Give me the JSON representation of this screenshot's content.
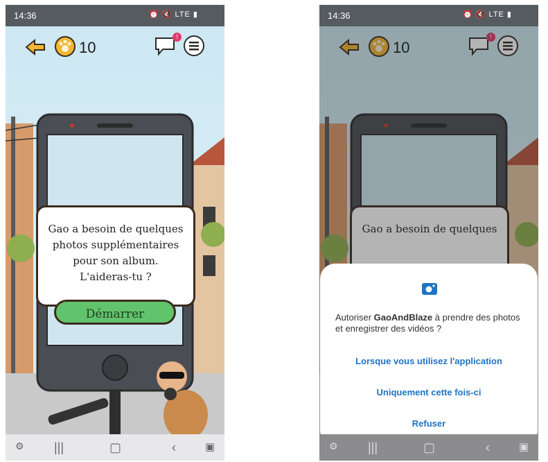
{
  "status": {
    "time": "14:36",
    "icons": "⏰ 🔇 LTE ▮"
  },
  "hud": {
    "paw_count": "10",
    "notification_badge": "!"
  },
  "game_dialog": {
    "lines": [
      "Gao a besoin de quelques",
      "photos supplémentaires",
      "pour son album.",
      "L'aideras-tu ?"
    ],
    "start_label": "Démarrer"
  },
  "permission": {
    "text_prefix": "Autoriser ",
    "app_name": "GaoAndBlaze",
    "text_suffix": " à prendre des photos et enregistrer des vidéos ?",
    "options": [
      "Lorsque vous utilisez l'application",
      "Uniquement cette fois-ci",
      "Refuser"
    ]
  },
  "colors": {
    "accent": "#1f73c2",
    "start_button": "#61c36b"
  },
  "icons": [
    "back-arrow-icon",
    "paw-coin-icon",
    "chat-bubble-icon",
    "menu-list-icon",
    "camera-icon",
    "recent-apps-icon",
    "home-icon",
    "back-nav-icon"
  ]
}
